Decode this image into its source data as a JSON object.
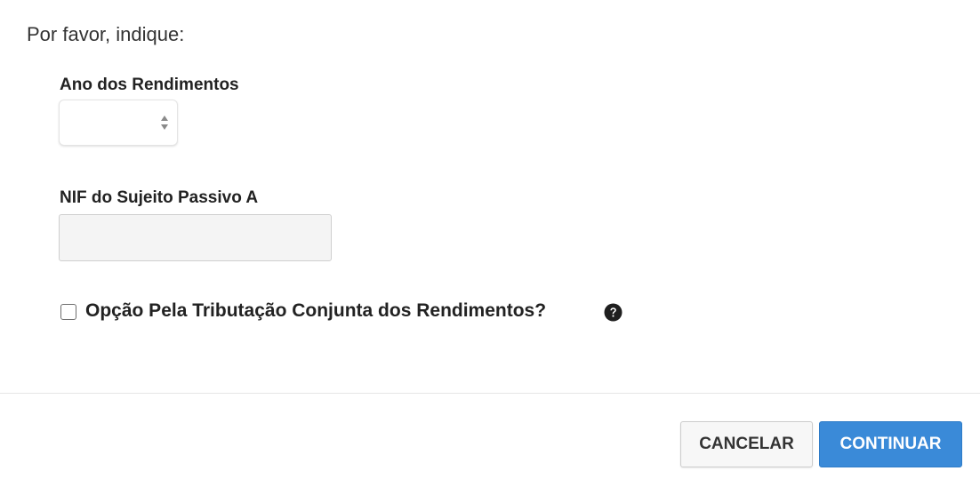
{
  "intro_text": "Por favor, indique:",
  "year_field": {
    "label": "Ano dos Rendimentos",
    "value": ""
  },
  "nif_field": {
    "label": "NIF do Sujeito Passivo A",
    "value": ""
  },
  "joint_taxation": {
    "label": "Opção Pela Tributação Conjunta dos Rendimentos?",
    "checked": false
  },
  "actions": {
    "cancel_label": "CANCELAR",
    "continue_label": "CONTINUAR"
  },
  "colors": {
    "primary_button": "#3a8ad8",
    "secondary_button": "#f7f7f7",
    "input_background": "#f4f4f4"
  },
  "icons": {
    "help": "question-circle-icon",
    "select_arrows": "up-down-arrows-icon"
  }
}
